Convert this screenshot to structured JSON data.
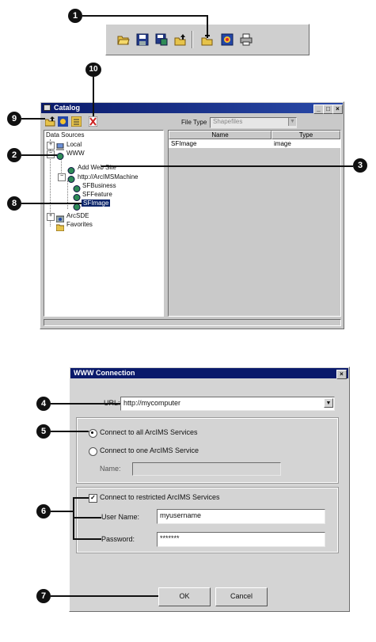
{
  "callouts": [
    "1",
    "2",
    "3",
    "4",
    "5",
    "6",
    "7",
    "8",
    "9",
    "10"
  ],
  "toolbar": {
    "icons": [
      "open-folder-icon",
      "save-icon",
      "save-as-icon",
      "up-folder-icon",
      "add-data-icon",
      "catalog-icon",
      "print-icon"
    ]
  },
  "catalog": {
    "title": "Catalog",
    "file_type_label": "File Type",
    "file_type_value": "Shapefiles",
    "tree_root": "Data Sources",
    "tree": [
      {
        "label": "Local",
        "icon": "computer-icon"
      },
      {
        "label": "WWW",
        "icon": "globe-icon"
      },
      {
        "label": "Add Web Site",
        "icon": "globe-icon"
      },
      {
        "label": "http://ArcIMSMachine",
        "icon": "globe-icon"
      },
      {
        "label": "SFBusiness",
        "icon": "service-icon"
      },
      {
        "label": "SFFeature",
        "icon": "service-icon"
      },
      {
        "label": "SFImage",
        "icon": "service-icon"
      },
      {
        "label": "ArcSDE",
        "icon": "database-icon"
      },
      {
        "label": "Favorites",
        "icon": "folder-icon"
      }
    ],
    "columns": [
      "Name",
      "Type"
    ],
    "rows": [
      {
        "name": "SFImage",
        "type": "image"
      }
    ]
  },
  "dialog": {
    "title": "WWW Connection",
    "url_label": "URL:",
    "url_value": "http://mycomputer",
    "option_all": "Connect to all ArcIMS Services",
    "option_one": "Connect to one ArcIMS Service",
    "name_label": "Name:",
    "restricted_label": "Connect to restricted ArcIMS Services",
    "username_label": "User Name:",
    "username_value": "myusername",
    "password_label": "Password:",
    "password_value": "*******",
    "ok_label": "OK",
    "cancel_label": "Cancel"
  }
}
